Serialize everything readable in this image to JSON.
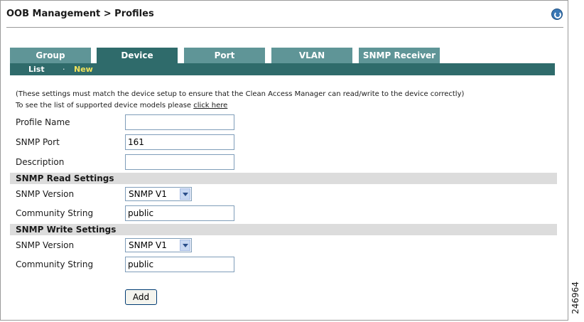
{
  "header": {
    "title": "OOB Management > Profiles"
  },
  "tabs": [
    {
      "label": "Group",
      "active": false
    },
    {
      "label": "Device",
      "active": true
    },
    {
      "label": "Port",
      "active": false
    },
    {
      "label": "VLAN",
      "active": false
    },
    {
      "label": "SNMP Receiver",
      "active": false
    }
  ],
  "subnav": {
    "list": "List",
    "separator": "·",
    "new": "New"
  },
  "notes": {
    "line1": "(These settings must match the device setup to ensure that the Clean Access Manager can read/write to the device correctly)",
    "line2_prefix": "To see the list of supported device models please ",
    "line2_link": "click here"
  },
  "form": {
    "profile_name": {
      "label": "Profile Name",
      "value": ""
    },
    "snmp_port": {
      "label": "SNMP Port",
      "value": "161"
    },
    "description": {
      "label": "Description",
      "value": ""
    },
    "read": {
      "heading": "SNMP Read Settings",
      "version_label": "SNMP Version",
      "version_value": "SNMP V1",
      "community_label": "Community String",
      "community_value": "public"
    },
    "write": {
      "heading": "SNMP Write Settings",
      "version_label": "SNMP Version",
      "version_value": "SNMP V1",
      "community_label": "Community String",
      "community_value": "public"
    },
    "add_button": "Add"
  },
  "figure_code": "246964",
  "icons": {
    "help": "help-refresh-icon"
  }
}
